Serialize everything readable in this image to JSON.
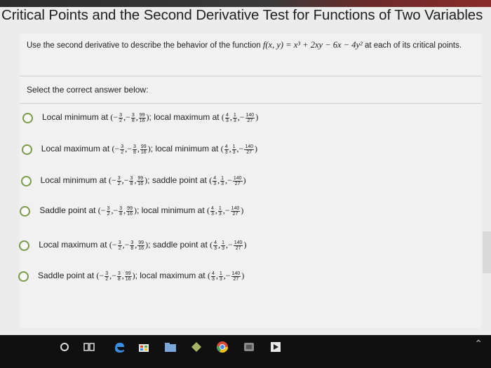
{
  "title": "Critical Points and the Second Derivative Test for Functions of Two Variables",
  "question": {
    "prefix": "Use the second derivative to describe the behavior of the function ",
    "function": "f(x, y) = x³ + 2xy − 6x − 4y²",
    "suffix": " at each of its critical points."
  },
  "instruction": "Select the correct answer below:",
  "options": [
    {
      "first": "Local minimum at",
      "second": "local maximum at"
    },
    {
      "first": "Local maximum at",
      "second": "local minimum at"
    },
    {
      "first": "Local minimum at",
      "second": "saddle point at"
    },
    {
      "first": "Saddle point at",
      "second": "local minimum at"
    },
    {
      "first": "Local maximum at",
      "second": "saddle point at"
    },
    {
      "first": "Saddle point at",
      "second": "local maximum at"
    }
  ],
  "point_a": {
    "x_num": "3",
    "x_den": "2",
    "y_num": "3",
    "y_den": "8",
    "z_num": "99",
    "z_den": "16"
  },
  "point_b": {
    "x_num": "4",
    "x_den": "3",
    "y_num": "1",
    "y_den": "3",
    "z_num": "140",
    "z_den": "27"
  },
  "taskbar_icons": [
    "cortana-icon",
    "task-view-icon",
    "edge-browser-icon",
    "store-icon",
    "files-icon",
    "app-icon",
    "chrome-icon",
    "app-icon-2",
    "app-icon-3"
  ]
}
